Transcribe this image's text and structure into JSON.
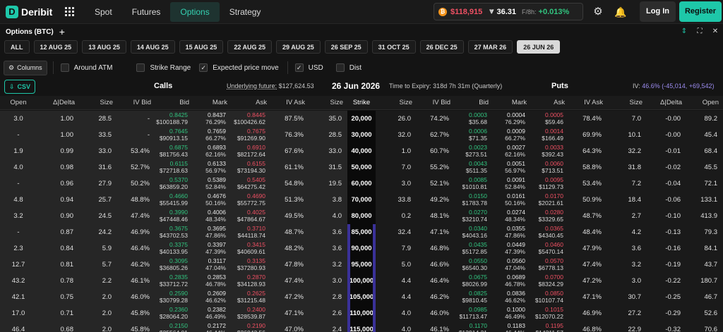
{
  "app": {
    "name": "Deribit",
    "logo_letter": "D",
    "nav": [
      "Spot",
      "Futures",
      "Options",
      "Strategy"
    ],
    "active_nav": "Options",
    "ticker": {
      "btc_symbol": "₿",
      "btc_price": "$118,915",
      "vol_icon": "DVOL-icon",
      "vol_value": "36.31",
      "funding_label": "F/8h:",
      "funding_value": "+0.013%"
    },
    "login_label": "Log In",
    "register_label": "Register"
  },
  "panel": {
    "title": "Options (BTC)",
    "plus": "+"
  },
  "expiries": [
    "ALL",
    "12 AUG 25",
    "13 AUG 25",
    "14 AUG 25",
    "15 AUG 25",
    "22 AUG 25",
    "29 AUG 25",
    "26 SEP 25",
    "31 OCT 25",
    "26 DEC 25",
    "27 MAR 26",
    "26 JUN 26"
  ],
  "active_expiry": "26 JUN 26",
  "toolbar": {
    "columns_label": "Columns",
    "around_atm_label": "Around ATM",
    "around_atm_checked": false,
    "strike_range_label": "Strike Range",
    "strike_range_checked": false,
    "expected_move_label": "Expected price move",
    "expected_move_checked": true,
    "usd_label": "USD",
    "usd_checked": true,
    "dist_label": "Dist",
    "dist_checked": false
  },
  "info": {
    "csv_label": "CSV",
    "calls_title": "Calls",
    "underlying_label": "Underlying future:",
    "underlying_value": "$127,624.53",
    "expiry_title": "26 Jun 2026",
    "time_to_expiry": "Time to Expiry: 318d 7h 31m (Quarterly)",
    "puts_title": "Puts",
    "iv_label": "IV:",
    "iv_value": "46.6% (-45,014, +69,542)"
  },
  "columns": {
    "calls": [
      "Open",
      "Δ|Delta",
      "Size",
      "IV Bid",
      "Bid",
      "Mark",
      "Ask",
      "IV Ask",
      "Size"
    ],
    "strike": "Strike",
    "puts": [
      "Size",
      "IV Bid",
      "Bid",
      "Mark",
      "Ask",
      "IV Ask",
      "Size",
      "Δ|Delta",
      "Open"
    ]
  },
  "rows": [
    {
      "strike": "20,000",
      "c_open": "3.0",
      "c_delta": "1.00",
      "c_size_bid": "28.5",
      "c_iv_bid": "-",
      "c_bid": "0.8425",
      "c_bid_usd": "$100188.79",
      "c_mark": "0.8437",
      "c_mark_iv": "76.29%",
      "c_ask": "0.8445",
      "c_ask_usd": "$100426.62",
      "c_iv_ask": "87.5%",
      "c_size_ask": "35.0",
      "p_size_bid": "26.0",
      "p_iv_bid": "74.2%",
      "p_bid": "0.0003",
      "p_bid_usd": "$35.68",
      "p_mark": "0.0004",
      "p_mark_iv": "76.29%",
      "p_ask": "0.0005",
      "p_ask_usd": "$59.46",
      "p_iv_ask": "78.4%",
      "p_size_ask": "7.0",
      "p_delta": "-0.00",
      "p_open": "89.2"
    },
    {
      "strike": "30,000",
      "c_open": "-",
      "c_delta": "1.00",
      "c_size_bid": "33.5",
      "c_iv_bid": "-",
      "c_bid": "0.7645",
      "c_bid_usd": "$90913.15",
      "c_mark": "0.7659",
      "c_mark_iv": "66.27%",
      "c_ask": "0.7675",
      "c_ask_usd": "$91269.90",
      "c_iv_ask": "76.3%",
      "c_size_ask": "28.5",
      "p_size_bid": "32.0",
      "p_iv_bid": "62.7%",
      "p_bid": "0.0006",
      "p_bid_usd": "$71.35",
      "p_mark": "0.0009",
      "p_mark_iv": "66.27%",
      "p_ask": "0.0014",
      "p_ask_usd": "$166.49",
      "p_iv_ask": "69.9%",
      "p_size_ask": "10.1",
      "p_delta": "-0.00",
      "p_open": "45.4"
    },
    {
      "strike": "40,000",
      "c_open": "1.9",
      "c_delta": "0.99",
      "c_size_bid": "33.0",
      "c_iv_bid": "53.4%",
      "c_bid": "0.6875",
      "c_bid_usd": "$81756.43",
      "c_mark": "0.6893",
      "c_mark_iv": "62.16%",
      "c_ask": "0.6910",
      "c_ask_usd": "$82172.64",
      "c_iv_ask": "67.6%",
      "c_size_ask": "33.0",
      "p_size_bid": "1.0",
      "p_iv_bid": "60.7%",
      "p_bid": "0.0023",
      "p_bid_usd": "$273.51",
      "p_mark": "0.0027",
      "p_mark_iv": "62.16%",
      "p_ask": "0.0033",
      "p_ask_usd": "$392.43",
      "p_iv_ask": "64.3%",
      "p_size_ask": "32.2",
      "p_delta": "-0.01",
      "p_open": "68.4"
    },
    {
      "strike": "50,000",
      "c_open": "4.0",
      "c_delta": "0.98",
      "c_size_bid": "31.6",
      "c_iv_bid": "52.7%",
      "c_bid": "0.6115",
      "c_bid_usd": "$72718.63",
      "c_mark": "0.6133",
      "c_mark_iv": "56.97%",
      "c_ask": "0.6155",
      "c_ask_usd": "$73194.30",
      "c_iv_ask": "61.1%",
      "c_size_ask": "31.5",
      "p_size_bid": "7.0",
      "p_iv_bid": "55.2%",
      "p_bid": "0.0043",
      "p_bid_usd": "$511.35",
      "p_mark": "0.0051",
      "p_mark_iv": "56.97%",
      "p_ask": "0.0060",
      "p_ask_usd": "$713.51",
      "p_iv_ask": "58.8%",
      "p_size_ask": "31.8",
      "p_delta": "-0.02",
      "p_open": "45.5"
    },
    {
      "strike": "60,000",
      "c_open": "-",
      "c_delta": "0.96",
      "c_size_bid": "27.9",
      "c_iv_bid": "50.2%",
      "c_bid": "0.5370",
      "c_bid_usd": "$63859.20",
      "c_mark": "0.5389",
      "c_mark_iv": "52.84%",
      "c_ask": "0.5405",
      "c_ask_usd": "$64275.42",
      "c_iv_ask": "54.8%",
      "c_size_ask": "19.5",
      "p_size_bid": "3.0",
      "p_iv_bid": "52.1%",
      "p_bid": "0.0085",
      "p_bid_usd": "$1010.81",
      "p_mark": "0.0091",
      "p_mark_iv": "52.84%",
      "p_ask": "0.0095",
      "p_ask_usd": "$1129.73",
      "p_iv_ask": "53.4%",
      "p_size_ask": "7.2",
      "p_delta": "-0.04",
      "p_open": "72.1"
    },
    {
      "strike": "70,000",
      "c_open": "4.8",
      "c_delta": "0.94",
      "c_size_bid": "25.7",
      "c_iv_bid": "48.8%",
      "c_bid": "0.4660",
      "c_bid_usd": "$55415.99",
      "c_mark": "0.4676",
      "c_mark_iv": "50.16%",
      "c_ask": "0.4690",
      "c_ask_usd": "$55772.75",
      "c_iv_ask": "51.3%",
      "c_size_ask": "3.8",
      "p_size_bid": "33.8",
      "p_iv_bid": "49.2%",
      "p_bid": "0.0150",
      "p_bid_usd": "$1783.78",
      "p_mark": "0.0161",
      "p_mark_iv": "50.16%",
      "p_ask": "0.0170",
      "p_ask_usd": "$2021.61",
      "p_iv_ask": "50.9%",
      "p_size_ask": "18.4",
      "p_delta": "-0.06",
      "p_open": "133.1"
    },
    {
      "strike": "80,000",
      "c_open": "3.2",
      "c_delta": "0.90",
      "c_size_bid": "24.5",
      "c_iv_bid": "47.4%",
      "c_bid": "0.3990",
      "c_bid_usd": "$47448.46",
      "c_mark": "0.4006",
      "c_mark_iv": "48.34%",
      "c_ask": "0.4025",
      "c_ask_usd": "$47864.67",
      "c_iv_ask": "49.5%",
      "c_size_ask": "4.0",
      "p_size_bid": "0.2",
      "p_iv_bid": "48.1%",
      "p_bid": "0.0270",
      "p_bid_usd": "$3210.74",
      "p_mark": "0.0274",
      "p_mark_iv": "48.34%",
      "p_ask": "0.0280",
      "p_ask_usd": "$3329.65",
      "p_iv_ask": "48.7%",
      "p_size_ask": "2.7",
      "p_delta": "-0.10",
      "p_open": "413.9"
    },
    {
      "strike": "85,000",
      "c_open": "-",
      "c_delta": "0.87",
      "c_size_bid": "24.2",
      "c_iv_bid": "46.9%",
      "c_bid": "0.3675",
      "c_bid_usd": "$43702.53",
      "c_mark": "0.3695",
      "c_mark_iv": "47.86%",
      "c_ask": "0.3710",
      "c_ask_usd": "$44118.74",
      "c_iv_ask": "48.7%",
      "c_size_ask": "3.6",
      "p_size_bid": "32.4",
      "p_iv_bid": "47.1%",
      "p_bid": "0.0340",
      "p_bid_usd": "$4043.16",
      "p_mark": "0.0355",
      "p_mark_iv": "47.86%",
      "p_ask": "0.0365",
      "p_ask_usd": "$4340.45",
      "p_iv_ask": "48.4%",
      "p_size_ask": "4.2",
      "p_delta": "-0.13",
      "p_open": "79.3"
    },
    {
      "strike": "90,000",
      "c_open": "2.3",
      "c_delta": "0.84",
      "c_size_bid": "5.9",
      "c_iv_bid": "46.4%",
      "c_bid": "0.3375",
      "c_bid_usd": "$40133.95",
      "c_mark": "0.3397",
      "c_mark_iv": "47.39%",
      "c_ask": "0.3415",
      "c_ask_usd": "$40609.61",
      "c_iv_ask": "48.2%",
      "c_size_ask": "3.6",
      "p_size_bid": "7.9",
      "p_iv_bid": "46.8%",
      "p_bid": "0.0435",
      "p_bid_usd": "$5172.85",
      "p_mark": "0.0449",
      "p_mark_iv": "47.39%",
      "p_ask": "0.0460",
      "p_ask_usd": "$5470.14",
      "p_iv_ask": "47.9%",
      "p_size_ask": "3.6",
      "p_delta": "-0.16",
      "p_open": "84.1"
    },
    {
      "strike": "95,000",
      "c_open": "12.7",
      "c_delta": "0.81",
      "c_size_bid": "5.7",
      "c_iv_bid": "46.2%",
      "c_bid": "0.3095",
      "c_bid_usd": "$36805.26",
      "c_mark": "0.3117",
      "c_mark_iv": "47.04%",
      "c_ask": "0.3135",
      "c_ask_usd": "$37280.93",
      "c_iv_ask": "47.8%",
      "c_size_ask": "3.2",
      "p_size_bid": "5.0",
      "p_iv_bid": "46.6%",
      "p_bid": "0.0550",
      "p_bid_usd": "$6540.30",
      "p_mark": "0.0560",
      "p_mark_iv": "47.04%",
      "p_ask": "0.0570",
      "p_ask_usd": "$6778.13",
      "p_iv_ask": "47.4%",
      "p_size_ask": "3.2",
      "p_delta": "-0.19",
      "p_open": "43.7"
    },
    {
      "strike": "100,000",
      "c_open": "43.2",
      "c_delta": "0.78",
      "c_size_bid": "2.2",
      "c_iv_bid": "46.1%",
      "c_bid": "0.2835",
      "c_bid_usd": "$33712.72",
      "c_mark": "0.2853",
      "c_mark_iv": "46.78%",
      "c_ask": "0.2870",
      "c_ask_usd": "$34128.93",
      "c_iv_ask": "47.4%",
      "c_size_ask": "3.0",
      "p_size_bid": "4.4",
      "p_iv_bid": "46.4%",
      "p_bid": "0.0675",
      "p_bid_usd": "$8026.99",
      "p_mark": "0.0689",
      "p_mark_iv": "46.78%",
      "p_ask": "0.0700",
      "p_ask_usd": "$8324.29",
      "p_iv_ask": "47.2%",
      "p_size_ask": "3.0",
      "p_delta": "-0.22",
      "p_open": "180.7"
    },
    {
      "strike": "105,000",
      "c_open": "42.1",
      "c_delta": "0.75",
      "c_size_bid": "2.0",
      "c_iv_bid": "46.0%",
      "c_bid": "0.2590",
      "c_bid_usd": "$30799.28",
      "c_mark": "0.2609",
      "c_mark_iv": "46.62%",
      "c_ask": "0.2625",
      "c_ask_usd": "$31215.48",
      "c_iv_ask": "47.2%",
      "c_size_ask": "2.8",
      "p_size_bid": "4.4",
      "p_iv_bid": "46.2%",
      "p_bid": "0.0825",
      "p_bid_usd": "$9810.45",
      "p_mark": "0.0836",
      "p_mark_iv": "46.62%",
      "p_ask": "0.0850",
      "p_ask_usd": "$10107.74",
      "p_iv_ask": "47.1%",
      "p_size_ask": "30.7",
      "p_delta": "-0.25",
      "p_open": "46.7"
    },
    {
      "strike": "110,000",
      "c_open": "17.0",
      "c_delta": "0.71",
      "c_size_bid": "2.0",
      "c_iv_bid": "45.8%",
      "c_bid": "0.2360",
      "c_bid_usd": "$28064.20",
      "c_mark": "0.2382",
      "c_mark_iv": "46.49%",
      "c_ask": "0.2400",
      "c_ask_usd": "$28539.87",
      "c_iv_ask": "47.1%",
      "c_size_ask": "2.6",
      "p_size_bid": "4.0",
      "p_iv_bid": "46.0%",
      "p_bid": "0.0985",
      "p_bid_usd": "$11713.47",
      "p_mark": "0.1000",
      "p_mark_iv": "46.49%",
      "p_ask": "0.1015",
      "p_ask_usd": "$12070.22",
      "p_iv_ask": "46.9%",
      "p_size_ask": "27.2",
      "p_delta": "-0.29",
      "p_open": "52.6"
    },
    {
      "strike": "115,000",
      "c_open": "46.4",
      "c_delta": "0.68",
      "c_size_bid": "2.0",
      "c_iv_bid": "45.8%",
      "c_bid": "0.2150",
      "c_bid_usd": "$25564.01",
      "c_mark": "0.2172",
      "c_mark_iv": "46.44%",
      "c_ask": "0.2190",
      "c_ask_usd": "$26043.56",
      "c_iv_ask": "47.0%",
      "c_size_ask": "2.4",
      "p_size_bid": "4.0",
      "p_iv_bid": "46.1%",
      "p_bid": "0.1170",
      "p_bid_usd": "$13914.21",
      "p_mark": "0.1183",
      "p_mark_iv": "46.44%",
      "p_ask": "0.1195",
      "p_ask_usd": "$14211.57",
      "p_iv_ask": "46.8%",
      "p_size_ask": "22.9",
      "p_delta": "-0.32",
      "p_open": "70.6"
    }
  ]
}
